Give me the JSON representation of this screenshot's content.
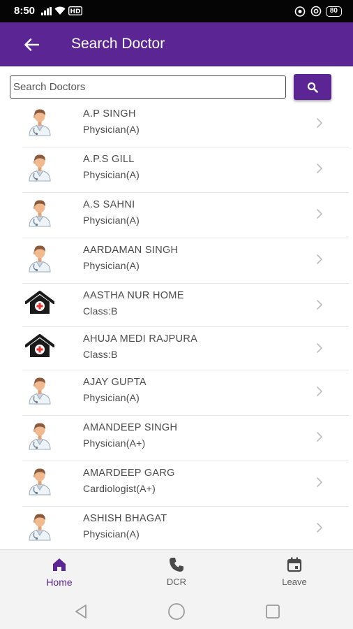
{
  "status_bar": {
    "time": "8:50",
    "battery": "80",
    "icons": [
      "signal-icon",
      "wifi-icon",
      "vowifi-icon",
      "hd-icon",
      "at-icon",
      "battery-icon"
    ]
  },
  "app_bar": {
    "title": "Search Doctor",
    "back_icon": "arrow-left-icon"
  },
  "search": {
    "placeholder": "Search Doctors",
    "value": "",
    "button_icon": "search-icon"
  },
  "doctors": [
    {
      "name": "A.P SINGH",
      "detail": "Physician(A)",
      "icon": "doctor-avatar-icon"
    },
    {
      "name": "A.P.S GILL",
      "detail": "Physician(A)",
      "icon": "doctor-avatar-icon"
    },
    {
      "name": "A.S SAHNI",
      "detail": "Physician(A)",
      "icon": "doctor-avatar-icon"
    },
    {
      "name": "AARDAMAN SINGH",
      "detail": "Physician(A)",
      "icon": "doctor-avatar-icon"
    },
    {
      "name": "AASTHA NUR HOME",
      "detail": "Class:B",
      "icon": "hospital-icon"
    },
    {
      "name": "AHUJA MEDI RAJPURA",
      "detail": "Class:B",
      "icon": "hospital-icon"
    },
    {
      "name": "AJAY GUPTA",
      "detail": "Physician(A)",
      "icon": "doctor-avatar-icon"
    },
    {
      "name": "AMANDEEP SINGH",
      "detail": "Physician(A+)",
      "icon": "doctor-avatar-icon"
    },
    {
      "name": "AMARDEEP GARG",
      "detail": "Cardiologist(A+)",
      "icon": "doctor-avatar-icon"
    },
    {
      "name": "ASHISH BHAGAT",
      "detail": "Physician(A)",
      "icon": "doctor-avatar-icon"
    }
  ],
  "bottom_nav": {
    "items": [
      {
        "label": "Home",
        "icon": "home-icon",
        "active": true
      },
      {
        "label": "DCR",
        "icon": "phone-icon",
        "active": false
      },
      {
        "label": "Leave",
        "icon": "calendar-icon",
        "active": false
      }
    ]
  },
  "colors": {
    "primary": "#5b2594",
    "status_bar": "#050505",
    "text": "#4a4a4a"
  }
}
